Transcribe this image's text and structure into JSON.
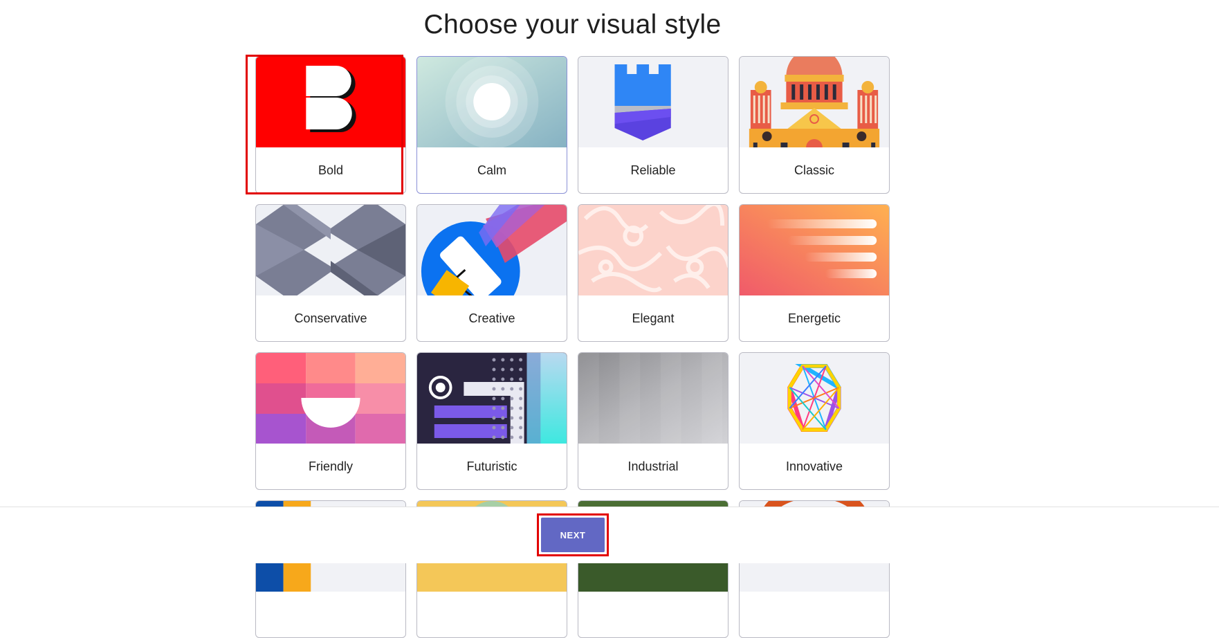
{
  "page": {
    "title": "Choose your visual style"
  },
  "styles": [
    {
      "label": "Bold",
      "selected": true,
      "thumb": "bold-b-thumbnail"
    },
    {
      "label": "Calm",
      "thumb": "calm-circles-thumbnail"
    },
    {
      "label": "Reliable",
      "thumb": "reliable-castle-thumbnail"
    },
    {
      "label": "Classic",
      "thumb": "classic-building-thumbnail"
    },
    {
      "label": "Conservative",
      "thumb": "conservative-pattern-thumbnail"
    },
    {
      "label": "Creative",
      "thumb": "creative-paint-roller-thumbnail"
    },
    {
      "label": "Elegant",
      "thumb": "elegant-floral-thumbnail"
    },
    {
      "label": "Energetic",
      "thumb": "energetic-gradient-thumbnail"
    },
    {
      "label": "Friendly",
      "thumb": "friendly-blocks-thumbnail"
    },
    {
      "label": "Futuristic",
      "thumb": "futuristic-dots-thumbnail"
    },
    {
      "label": "Industrial",
      "thumb": "industrial-metal-thumbnail"
    },
    {
      "label": "Innovative",
      "thumb": "innovative-hexagon-thumbnail"
    }
  ],
  "footer": {
    "next_label": "NEXT"
  },
  "colors": {
    "accent": "#6268c4",
    "selection": "#e20000"
  }
}
